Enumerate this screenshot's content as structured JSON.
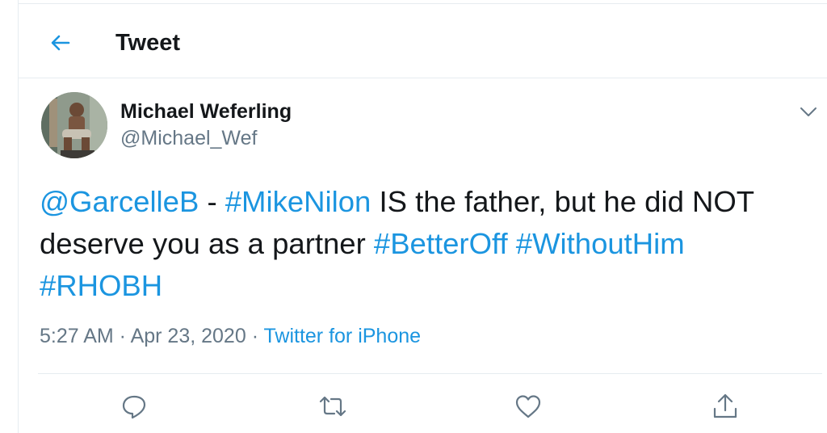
{
  "header": {
    "title": "Tweet",
    "back_icon": "arrow-left-icon"
  },
  "author": {
    "name": "Michael Weferling",
    "handle": "@Michael_Wef"
  },
  "tweet": {
    "segments": [
      {
        "text": "@GarcelleB",
        "link": true
      },
      {
        "text": " - ",
        "link": false
      },
      {
        "text": "#MikeNilon",
        "link": true
      },
      {
        "text": " IS the father, but he did NOT deserve you as a partner ",
        "link": false
      },
      {
        "text": "#BetterOff",
        "link": true
      },
      {
        "text": " ",
        "link": false
      },
      {
        "text": "#WithoutHim",
        "link": true
      },
      {
        "text": " ",
        "link": false
      },
      {
        "text": "#RHOBH",
        "link": true
      }
    ]
  },
  "meta": {
    "time": "5:27 AM",
    "separator": " · ",
    "date": "Apr 23, 2020",
    "source": "Twitter for iPhone"
  },
  "actions": [
    "reply-icon",
    "retweet-icon",
    "like-icon",
    "share-icon"
  ],
  "colors": {
    "link": "#1b95e0",
    "secondary": "#657786",
    "text": "#14171a",
    "border": "#e6ecf0"
  }
}
